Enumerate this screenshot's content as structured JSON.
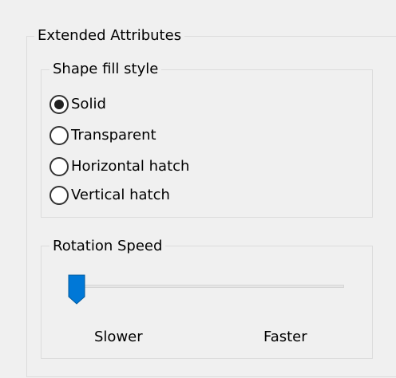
{
  "extended_attributes": {
    "title": "Extended Attributes",
    "shape_fill_style": {
      "title": "Shape fill style",
      "options": [
        {
          "label": "Solid",
          "selected": true
        },
        {
          "label": "Transparent",
          "selected": false
        },
        {
          "label": "Horizontal hatch",
          "selected": false
        },
        {
          "label": "Vertical hatch",
          "selected": false
        }
      ]
    },
    "rotation_speed": {
      "title": "Rotation Speed",
      "min_label": "Slower",
      "max_label": "Faster",
      "value_fraction": 0.0
    }
  },
  "colors": {
    "slider_thumb": "#0078d7",
    "background": "#f0f0f0"
  }
}
